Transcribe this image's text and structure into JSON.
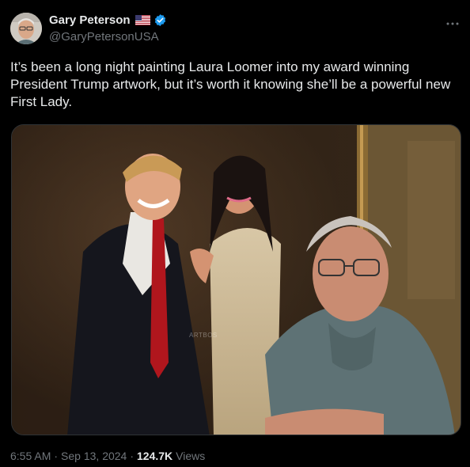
{
  "author": {
    "display_name": "Gary Peterson",
    "handle": "@GaryPetersonUSA",
    "badges": [
      "us-flag-icon",
      "verified-badge-icon"
    ],
    "verified_color": "#1d9bf0"
  },
  "more_icon": "more-horizontal-icon",
  "tweet": {
    "text": "It’s been a long night painting Laura Loomer into my award winning President Trump artwork, but it’s worth it knowing she’ll be a powerful new First Lady."
  },
  "media": {
    "watermark": "ARTBOS"
  },
  "meta": {
    "time": "6:55 AM",
    "separator": "·",
    "date": "Sep 13, 2024",
    "views_count": "124.7K",
    "views_label": "Views"
  },
  "colors": {
    "background": "#000000",
    "text": "#e7e9ea",
    "muted": "#71767b",
    "border": "#2f3336"
  }
}
